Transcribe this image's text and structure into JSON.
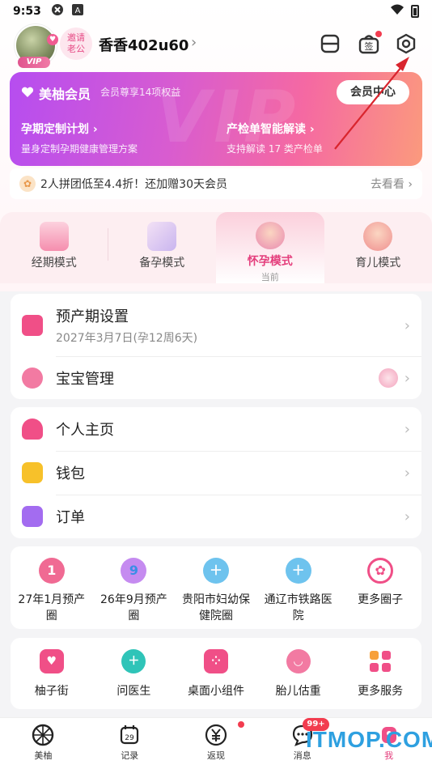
{
  "status_bar": {
    "time": "9:53"
  },
  "profile": {
    "vip_badge": "VIP",
    "invite_line1": "邀请",
    "invite_line2": "老公",
    "username": "香香402u60"
  },
  "vip_card": {
    "title": "美柚会员",
    "subtitle": "会员尊享14项权益",
    "center_button": "会员中心",
    "watermark": "VIP",
    "feature_left_title": "孕期定制计划",
    "feature_left_desc": "量身定制孕期健康管理方案",
    "feature_right_title": "产检单智能解读",
    "feature_right_desc": "支持解读 17 类产检单"
  },
  "promo": {
    "text": "2人拼团低至4.4折！还加赠30天会员",
    "more": "去看看"
  },
  "modes": [
    {
      "label": "经期模式"
    },
    {
      "label": "备孕模式"
    },
    {
      "label": "怀孕模式",
      "current": "当前"
    },
    {
      "label": "育儿模式"
    }
  ],
  "pregnancy_card": {
    "due_label": "预产期设置",
    "due_value": "2027年3月7日(孕12周6天)",
    "baby_label": "宝宝管理"
  },
  "account_card": {
    "home_label": "个人主页",
    "wallet_label": "钱包",
    "order_label": "订单"
  },
  "circles": [
    {
      "label": "27年1月预产圈",
      "icon_text": "1"
    },
    {
      "label": "26年9月预产圈",
      "icon_text": "9"
    },
    {
      "label": "贵阳市妇幼保健院圈",
      "icon_text": ""
    },
    {
      "label": "通辽市铁路医院",
      "icon_text": ""
    },
    {
      "label": "更多圈子",
      "icon_text": ""
    }
  ],
  "services": [
    {
      "label": "柚子街"
    },
    {
      "label": "问医生"
    },
    {
      "label": "桌面小组件"
    },
    {
      "label": "胎儿估重"
    },
    {
      "label": "更多服务"
    }
  ],
  "bottom_nav": [
    {
      "label": "美柚"
    },
    {
      "label": "记录",
      "icon_text": "29"
    },
    {
      "label": "返现"
    },
    {
      "label": "消息",
      "badge": "99+"
    },
    {
      "label": "我"
    }
  ],
  "watermark": "ITMOP.COM",
  "colors": {
    "accent": "#e43e7c",
    "vip_gradient_start": "#b64df0",
    "vip_gradient_end": "#fb9a7d"
  }
}
